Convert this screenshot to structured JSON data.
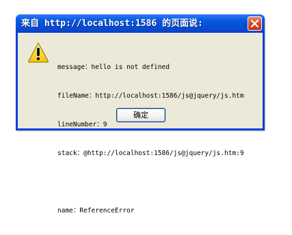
{
  "window": {
    "title": "来自 http://localhost:1586 的页面说:",
    "close_icon": "close-icon"
  },
  "content": {
    "icon": "warning-icon",
    "lines": [
      "message：hello is not defined",
      "fileName：http://localhost:1586/js@jquery/js.htm",
      "lineNumber：9",
      "stack：@http://localhost:1586/js@jquery/js.htm:9",
      "",
      "name：ReferenceError"
    ]
  },
  "buttons": {
    "ok_label": "确定"
  },
  "colors": {
    "titlebar": "#0a3ed8",
    "body": "#ece9d8",
    "close_button": "#d4472a"
  }
}
